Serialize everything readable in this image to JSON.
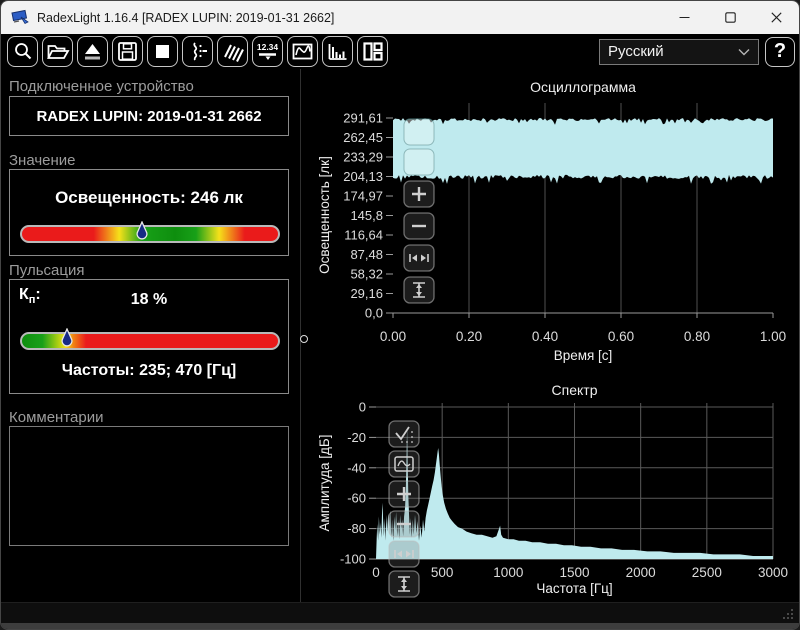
{
  "window": {
    "title": "RadexLight 1.16.4 [RADEX LUPIN: 2019-01-31 2662]"
  },
  "toolbar": {
    "digital_icon_label": "12.34",
    "language": "Русский",
    "help_label": "?"
  },
  "panels": {
    "device": {
      "header": "Подключенное устройство",
      "name": "RADEX LUPIN: 2019-01-31 2662"
    },
    "value": {
      "header": "Значение",
      "reading": "Освещенность: 246 лк",
      "marker_pct": 47
    },
    "pulsation": {
      "header": "Пульсация",
      "kp_base": "К",
      "kp_sub": "п",
      "kp_colon": ":",
      "reading": "18 %",
      "marker_pct": 18,
      "frequencies": "Частоты: 235; 470 [Гц]"
    },
    "comments": {
      "header": "Комментарии",
      "text": ""
    }
  },
  "colors": {
    "waveform": "#bfeaee",
    "scale_green": "#0e8e0e",
    "scale_yellow": "#f5e11a",
    "scale_red": "#ea1b1b",
    "marker_blue": "#172b85",
    "grid": "#4f4f4f",
    "axis": "#9a9a9a",
    "tick_text": "#dcdcdc"
  },
  "chart_data": [
    {
      "type": "line",
      "title": "Осциллограмма",
      "xlabel": "Время [с]",
      "ylabel": "Освещенность [лк]",
      "xlim": [
        0,
        1
      ],
      "ylim": [
        0,
        291.61
      ],
      "x_ticks": [
        "0.00",
        "0.20",
        "0.40",
        "0.60",
        "0.80",
        "1.00"
      ],
      "y_ticks": [
        "291,61",
        "262,45",
        "233,29",
        "204,13",
        "174,97",
        "145,8",
        "116,64",
        "87,48",
        "58,32",
        "29,16",
        "0,0"
      ],
      "band": {
        "min": 205,
        "max": 290
      },
      "overlay_buttons": [
        "autoscale",
        "fit-curve",
        "zoom-in",
        "zoom-out",
        "fit-horizontal",
        "fit-vertical"
      ]
    },
    {
      "type": "area",
      "title": "Спектр",
      "xlabel": "Частота [Гц]",
      "ylabel": "Амплитуда [дБ]",
      "xlim": [
        0,
        3000
      ],
      "ylim": [
        -100,
        0
      ],
      "x_ticks": [
        "0",
        "500",
        "1000",
        "1500",
        "2000",
        "2500",
        "3000"
      ],
      "y_ticks": [
        "0",
        "-20",
        "-40",
        "-60",
        "-80",
        "-100"
      ],
      "peaks_hz": [
        235,
        470
      ],
      "overlay_buttons": [
        "autoscale",
        "fit-curve",
        "zoom-in",
        "zoom-out",
        "fit-horizontal",
        "fit-vertical"
      ],
      "points": [
        [
          0,
          -100
        ],
        [
          5,
          -86
        ],
        [
          10,
          -77
        ],
        [
          16,
          -88
        ],
        [
          22,
          -72
        ],
        [
          28,
          -84
        ],
        [
          34,
          -76
        ],
        [
          40,
          -86
        ],
        [
          46,
          -68
        ],
        [
          50,
          -63
        ],
        [
          54,
          -74
        ],
        [
          60,
          -85
        ],
        [
          66,
          -73
        ],
        [
          72,
          -88
        ],
        [
          78,
          -71
        ],
        [
          85,
          -82
        ],
        [
          92,
          -70
        ],
        [
          100,
          -79
        ],
        [
          108,
          -68
        ],
        [
          115,
          -86
        ],
        [
          122,
          -74
        ],
        [
          130,
          -88
        ],
        [
          138,
          -72
        ],
        [
          145,
          -81
        ],
        [
          152,
          -69
        ],
        [
          160,
          -85
        ],
        [
          168,
          -74
        ],
        [
          175,
          -87
        ],
        [
          182,
          -71
        ],
        [
          190,
          -80
        ],
        [
          198,
          -74
        ],
        [
          205,
          -85
        ],
        [
          212,
          -72
        ],
        [
          220,
          -66
        ],
        [
          226,
          -52
        ],
        [
          231,
          -30
        ],
        [
          235,
          -13
        ],
        [
          239,
          -34
        ],
        [
          244,
          -58
        ],
        [
          250,
          -72
        ],
        [
          256,
          -84
        ],
        [
          262,
          -73
        ],
        [
          270,
          -86
        ],
        [
          278,
          -74
        ],
        [
          286,
          -84
        ],
        [
          295,
          -71
        ],
        [
          305,
          -83
        ],
        [
          315,
          -75
        ],
        [
          325,
          -88
        ],
        [
          335,
          -78
        ],
        [
          345,
          -86
        ],
        [
          355,
          -74
        ],
        [
          365,
          -82
        ],
        [
          375,
          -73
        ],
        [
          385,
          -68
        ],
        [
          395,
          -64
        ],
        [
          405,
          -60
        ],
        [
          415,
          -56
        ],
        [
          425,
          -52
        ],
        [
          435,
          -48
        ],
        [
          445,
          -43
        ],
        [
          453,
          -38
        ],
        [
          460,
          -33
        ],
        [
          466,
          -29
        ],
        [
          470,
          -27
        ],
        [
          475,
          -31
        ],
        [
          481,
          -38
        ],
        [
          488,
          -45
        ],
        [
          496,
          -52
        ],
        [
          505,
          -58
        ],
        [
          515,
          -63
        ],
        [
          528,
          -67
        ],
        [
          542,
          -70
        ],
        [
          558,
          -73
        ],
        [
          575,
          -75
        ],
        [
          595,
          -77
        ],
        [
          620,
          -79
        ],
        [
          650,
          -80
        ],
        [
          685,
          -82
        ],
        [
          720,
          -83
        ],
        [
          760,
          -84
        ],
        [
          800,
          -84
        ],
        [
          840,
          -85
        ],
        [
          880,
          -86
        ],
        [
          910,
          -85
        ],
        [
          930,
          -80
        ],
        [
          938,
          -78
        ],
        [
          946,
          -84
        ],
        [
          960,
          -86
        ],
        [
          1000,
          -87
        ],
        [
          1040,
          -87
        ],
        [
          1080,
          -88
        ],
        [
          1130,
          -88
        ],
        [
          1180,
          -89
        ],
        [
          1240,
          -89
        ],
        [
          1300,
          -90
        ],
        [
          1360,
          -90
        ],
        [
          1420,
          -91
        ],
        [
          1480,
          -91
        ],
        [
          1550,
          -92
        ],
        [
          1620,
          -92
        ],
        [
          1700,
          -93
        ],
        [
          1780,
          -93
        ],
        [
          1860,
          -94
        ],
        [
          1950,
          -94
        ],
        [
          2050,
          -95
        ],
        [
          2150,
          -95
        ],
        [
          2250,
          -96
        ],
        [
          2350,
          -96
        ],
        [
          2450,
          -96
        ],
        [
          2550,
          -97
        ],
        [
          2650,
          -97
        ],
        [
          2750,
          -97
        ],
        [
          2850,
          -98
        ],
        [
          2950,
          -98
        ],
        [
          3000,
          -98
        ]
      ]
    }
  ]
}
